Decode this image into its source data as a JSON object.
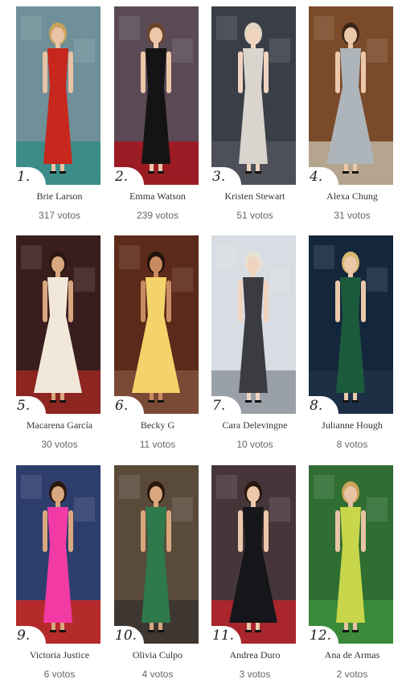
{
  "entries": [
    {
      "rank": "1.",
      "name": "Brie Larson",
      "votes": "317 votos",
      "bg": "#6f8f99",
      "floor": "#3c8c88",
      "dress": "#c7271c",
      "skin": "#e8c3a4",
      "hair": "#c9a35a"
    },
    {
      "rank": "2.",
      "name": "Emma Watson",
      "votes": "239 votos",
      "bg": "#5a4a56",
      "floor": "#9b1b24",
      "dress": "#141414",
      "skin": "#ecc8aa",
      "hair": "#6b4428"
    },
    {
      "rank": "3.",
      "name": "Kristen Stewart",
      "votes": "51 votos",
      "bg": "#3a3f47",
      "floor": "#4d5059",
      "dress": "#d9d4ce",
      "skin": "#f0d4bf",
      "hair": "#e0d6c4"
    },
    {
      "rank": "4.",
      "name": "Alexa Chung",
      "votes": "31 votos",
      "bg": "#7a4a2a",
      "floor": "#b5a48e",
      "dress": "#aeb5ba",
      "skin": "#ecc8aa",
      "hair": "#3b2618"
    },
    {
      "rank": "5.",
      "name": "Macarena García",
      "votes": "30 votos",
      "bg": "#3a1e1e",
      "floor": "#8d2520",
      "dress": "#f2e8da",
      "skin": "#d9a77f",
      "hair": "#2a170e"
    },
    {
      "rank": "6.",
      "name": "Becky G",
      "votes": "11 votos",
      "bg": "#5c2a1a",
      "floor": "#7a4a36",
      "dress": "#f4d36a",
      "skin": "#c98b62",
      "hair": "#1f120b"
    },
    {
      "rank": "7.",
      "name": "Cara Delevingne",
      "votes": "10 votos",
      "bg": "#d8dde3",
      "floor": "#9aa0a8",
      "dress": "#3b3b42",
      "skin": "#f0d4bf",
      "hair": "#e8e2d6"
    },
    {
      "rank": "8.",
      "name": "Julianne Hough",
      "votes": "8 votos",
      "bg": "#14263c",
      "floor": "#1c2f45",
      "dress": "#1c5a3c",
      "skin": "#ecc8aa",
      "hair": "#d8b772"
    },
    {
      "rank": "9.",
      "name": "Victoria Justice",
      "votes": "6 votos",
      "bg": "#2d3e6d",
      "floor": "#b52a2a",
      "dress": "#f23aa5",
      "skin": "#d9a77f",
      "hair": "#2a170e"
    },
    {
      "rank": "10.",
      "name": "Olivia Culpo",
      "votes": "4 votos",
      "bg": "#5a4a3a",
      "floor": "#3e3630",
      "dress": "#2f7a4a",
      "skin": "#d9a77f",
      "hair": "#2a170e"
    },
    {
      "rank": "11.",
      "name": "Andrea Duro",
      "votes": "3 votos",
      "bg": "#46363a",
      "floor": "#a8262c",
      "dress": "#15161a",
      "skin": "#ecc8aa",
      "hair": "#2a170e"
    },
    {
      "rank": "12.",
      "name": "Ana de Armas",
      "votes": "2 votos",
      "bg": "#2f6d33",
      "floor": "#3a8a3a",
      "dress": "#c7d64a",
      "skin": "#e8c3a4",
      "hair": "#c9a35a"
    }
  ]
}
